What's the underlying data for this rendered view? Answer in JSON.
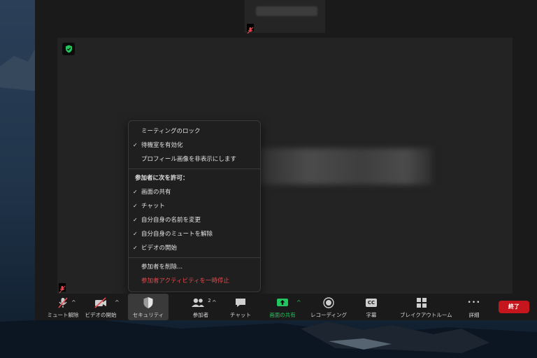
{
  "security_menu": {
    "items": [
      {
        "label": "ミーティングのロック",
        "checked": false
      },
      {
        "label": "待機室を有効化",
        "checked": true
      },
      {
        "label": "プロフィール画像を非表示にします",
        "checked": false
      }
    ],
    "allow_header": "参加者に次を許可：",
    "allow_items": [
      {
        "label": "画面の共有",
        "checked": true
      },
      {
        "label": "チャット",
        "checked": true
      },
      {
        "label": "自分自身の名前を変更",
        "checked": true
      },
      {
        "label": "自分自身のミュートを解除",
        "checked": true
      },
      {
        "label": "ビデオの開始",
        "checked": true
      }
    ],
    "remove_label": "参加者を削除...",
    "suspend_label": "参加者アクティビティを一時停止",
    "check_glyph": "✓"
  },
  "toolbar": {
    "mute_label": "ミュート解除",
    "video_label": "ビデオの開始",
    "security_label": "セキュリティ",
    "participants_label": "参加者",
    "participants_count": "2",
    "chat_label": "チャット",
    "share_label": "画面の共有",
    "record_label": "レコーディング",
    "cc_text": "CC",
    "captions_label": "字幕",
    "breakout_label": "ブレイクアウトルーム",
    "more_label": "詳細",
    "more_glyph": "•••",
    "end_label": "終了",
    "caret": "^"
  },
  "colors": {
    "accent_green": "#22c55e",
    "end_red": "#c4161c",
    "danger_text": "#e5484d"
  }
}
